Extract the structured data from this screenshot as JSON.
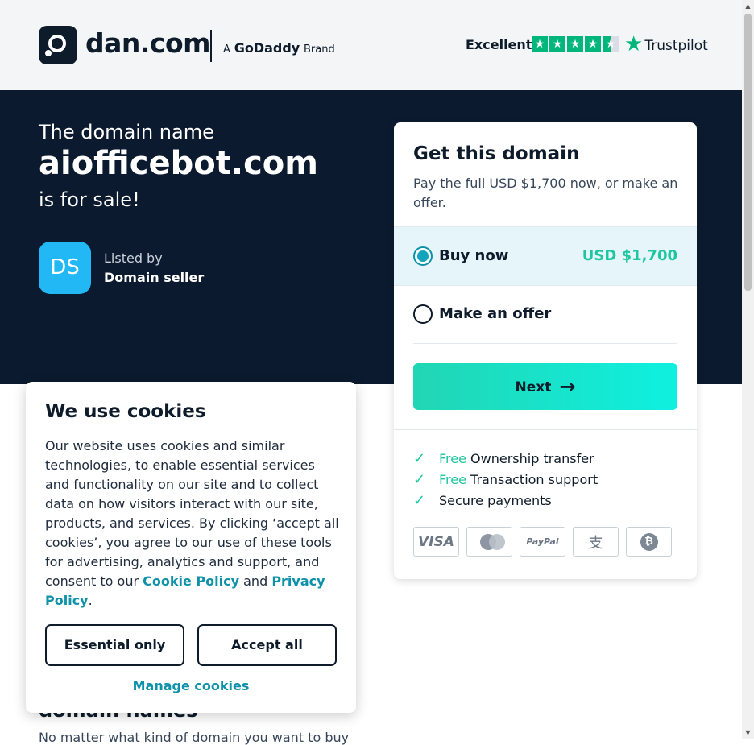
{
  "header": {
    "logo_text": "dan.com",
    "brand_prefix": "A",
    "brand_name": "GoDaddy",
    "brand_suffix": "Brand",
    "trustpilot_rating": "Excellent",
    "trustpilot_stars": 4.5,
    "trustpilot_name": "Trustpilot"
  },
  "hero": {
    "pre": "The domain name",
    "domain": "aiofficebot.com",
    "post": "is for sale!",
    "avatar_initials": "DS",
    "listed_by": "Listed by",
    "seller": "Domain seller"
  },
  "card": {
    "title": "Get this domain",
    "subtitle": "Pay the full USD $1,700 now, or make an offer.",
    "buy_now_label": "Buy now",
    "buy_now_price": "USD $1,700",
    "make_offer_label": "Make an offer",
    "next_label": "Next",
    "features": [
      {
        "free": "Free",
        "text": " Ownership transfer"
      },
      {
        "free": "Free",
        "text": " Transaction support"
      },
      {
        "free": "",
        "text": "Secure payments"
      }
    ],
    "payment_methods": [
      "VISA",
      "mastercard",
      "PayPal",
      "alipay",
      "bitcoin"
    ]
  },
  "below": {
    "heading": "domain names",
    "text": "No matter what kind of domain you want to buy"
  },
  "cookie": {
    "title": "We use cookies",
    "body_before": "Our website uses cookies and similar technologies, to enable essential services and functionality on our site and to collect data on how visitors interact with our site, products, and services. By clicking ‘accept all cookies’, you agree to our use of these tools for advertising, analytics and support, and consent to our ",
    "cookie_policy_link": "Cookie Policy",
    "and_text": " and ",
    "privacy_policy_link": "Privacy Policy",
    "period": ".",
    "essential_only": "Essential only",
    "accept_all": "Accept all",
    "manage_cookies": "Manage cookies"
  },
  "colors": {
    "hero_bg": "#0b1a2e",
    "accent_teal": "#1dc6a1",
    "link_teal": "#0e92a9",
    "trustpilot_green": "#00b67a"
  }
}
